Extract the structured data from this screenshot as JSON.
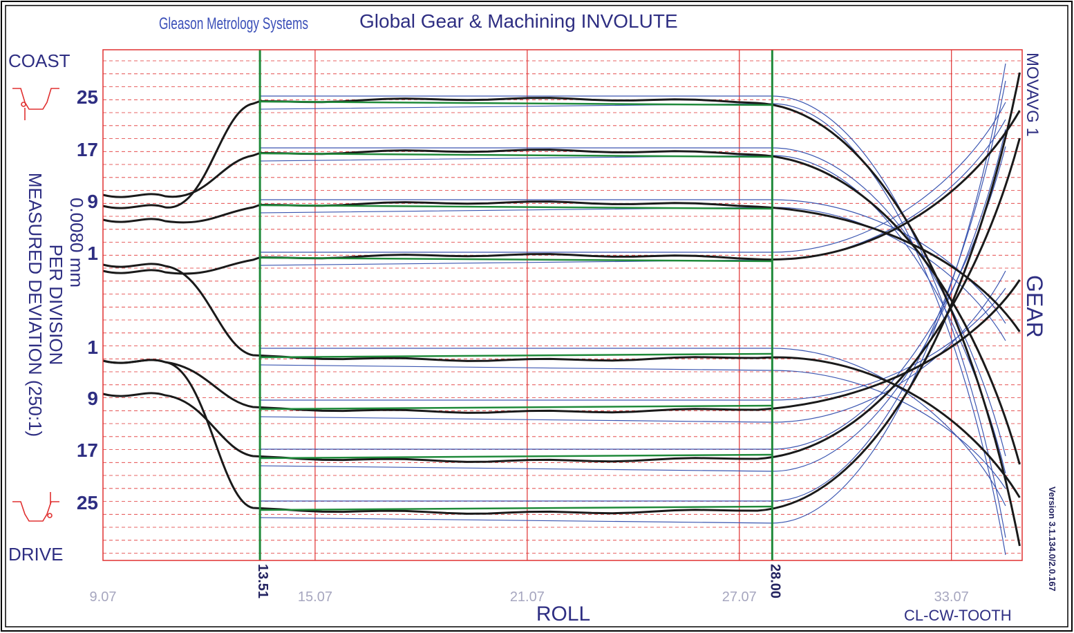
{
  "header": {
    "brand": "Gleason Metrology Systems",
    "title": "Global Gear & Machining  INVOLUTE"
  },
  "labels": {
    "coast": "COAST",
    "drive": "DRIVE",
    "ylabel_line1": "MEASURED DEVIATION (250:1)",
    "ylabel_line2": "PER DIVISION",
    "ylabel_line3": "0.0080 mm",
    "right_top": "MOVAVG 1",
    "right_mid": "GEAR",
    "version": "Version 3.1.134.0/2.0.167",
    "xlabel": "ROLL",
    "corner": "CL-CW-TOOTH"
  },
  "colors": {
    "grid_red": "#e03030",
    "eval_green": "#1f8a3a",
    "trace_black": "#1a1a1a",
    "tolerance_blue": "#3a55b0",
    "text_navy": "#2e2e82"
  },
  "icons": {
    "coast": "tooth-profile-coast-icon",
    "drive": "tooth-profile-drive-icon"
  },
  "chart_data": {
    "type": "line",
    "xlabel": "ROLL",
    "x_ticks": [
      "9.07",
      "15.07",
      "21.07",
      "27.07",
      "33.07"
    ],
    "x_range": [
      9.07,
      35.07
    ],
    "evaluation_limits": [
      "13.51",
      "28.00"
    ],
    "evaluation_range": [
      13.51,
      28.0
    ],
    "grid": true,
    "groups": [
      {
        "side": "COAST",
        "label": "25",
        "tooth": 25
      },
      {
        "side": "COAST",
        "label": "17",
        "tooth": 17
      },
      {
        "side": "COAST",
        "label": "9",
        "tooth": 9
      },
      {
        "side": "COAST",
        "label": "1",
        "tooth": 1
      },
      {
        "side": "DRIVE",
        "label": "1",
        "tooth": 1
      },
      {
        "side": "DRIVE",
        "label": "9",
        "tooth": 9
      },
      {
        "side": "DRIVE",
        "label": "17",
        "tooth": 17
      },
      {
        "side": "DRIVE",
        "label": "25",
        "tooth": 25
      }
    ]
  }
}
